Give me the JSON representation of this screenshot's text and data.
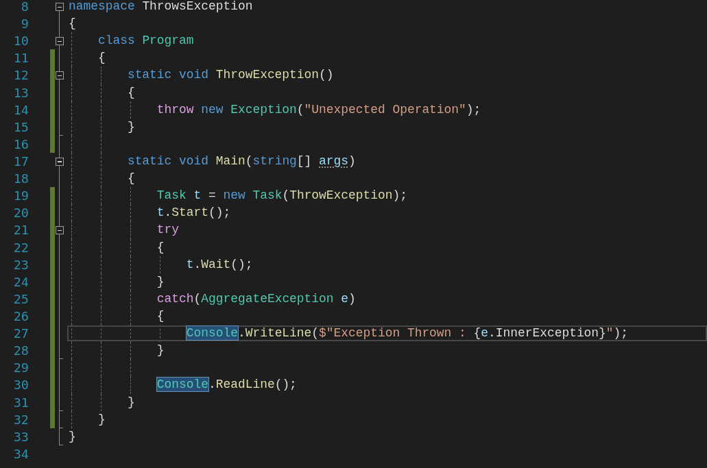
{
  "editor": {
    "lines": [
      {
        "number": "8",
        "changed": false,
        "collapsible": true,
        "fold_end": false,
        "tokens": [
          {
            "text": "namespace ",
            "kind": "keyword"
          },
          {
            "text": "ThrowsException",
            "kind": "plain"
          }
        ]
      },
      {
        "number": "9",
        "changed": false,
        "collapsible": false,
        "fold_end": false,
        "tokens": [
          {
            "text": "{",
            "kind": "plain"
          }
        ]
      },
      {
        "number": "10",
        "changed": false,
        "collapsible": true,
        "fold_end": false,
        "tokens": [
          {
            "text": "    class ",
            "kind": "keyword"
          },
          {
            "text": "Program",
            "kind": "type"
          }
        ]
      },
      {
        "number": "11",
        "changed": true,
        "collapsible": false,
        "fold_end": false,
        "tokens": [
          {
            "text": "    {",
            "kind": "plain"
          }
        ]
      },
      {
        "number": "12",
        "changed": true,
        "collapsible": true,
        "fold_end": false,
        "tokens": [
          {
            "text": "        static void ",
            "kind": "keyword"
          },
          {
            "text": "ThrowException",
            "kind": "method"
          },
          {
            "text": "()",
            "kind": "plain"
          }
        ]
      },
      {
        "number": "13",
        "changed": true,
        "collapsible": false,
        "fold_end": false,
        "tokens": [
          {
            "text": "        {",
            "kind": "plain"
          }
        ]
      },
      {
        "number": "14",
        "changed": true,
        "collapsible": false,
        "fold_end": false,
        "tokens": [
          {
            "text": "            throw ",
            "kind": "control"
          },
          {
            "text": "new ",
            "kind": "keyword"
          },
          {
            "text": "Exception",
            "kind": "type"
          },
          {
            "text": "(",
            "kind": "plain"
          },
          {
            "text": "\"Unexpected Operation\"",
            "kind": "string"
          },
          {
            "text": ");",
            "kind": "plain"
          }
        ]
      },
      {
        "number": "15",
        "changed": true,
        "collapsible": false,
        "fold_end": true,
        "tokens": [
          {
            "text": "        }",
            "kind": "plain"
          }
        ]
      },
      {
        "number": "16",
        "changed": true,
        "collapsible": false,
        "fold_end": false
      },
      {
        "number": "17",
        "changed": false,
        "collapsible": true,
        "fold_end": false,
        "tokens": [
          {
            "text": "        static void ",
            "kind": "keyword"
          },
          {
            "text": "Main",
            "kind": "method"
          },
          {
            "text": "(",
            "kind": "plain"
          },
          {
            "text": "string",
            "kind": "keyword"
          },
          {
            "text": "[] ",
            "kind": "plain"
          },
          {
            "text": "args",
            "kind": "hint"
          },
          {
            "text": ")",
            "kind": "plain"
          }
        ]
      },
      {
        "number": "18",
        "changed": false,
        "collapsible": false,
        "fold_end": false,
        "tokens": [
          {
            "text": "        {",
            "kind": "plain"
          }
        ]
      },
      {
        "number": "19",
        "changed": true,
        "collapsible": false,
        "fold_end": false,
        "tokens": [
          {
            "text": "            Task ",
            "kind": "type"
          },
          {
            "text": "t",
            "kind": "param"
          },
          {
            "text": " = ",
            "kind": "plain"
          },
          {
            "text": "new ",
            "kind": "keyword"
          },
          {
            "text": "Task",
            "kind": "type"
          },
          {
            "text": "(",
            "kind": "plain"
          },
          {
            "text": "ThrowException",
            "kind": "method"
          },
          {
            "text": ");",
            "kind": "plain"
          }
        ]
      },
      {
        "number": "20",
        "changed": true,
        "collapsible": false,
        "fold_end": false,
        "tokens": [
          {
            "text": "            t",
            "kind": "param"
          },
          {
            "text": ".",
            "kind": "plain"
          },
          {
            "text": "Start",
            "kind": "method"
          },
          {
            "text": "();",
            "kind": "plain"
          }
        ]
      },
      {
        "number": "21",
        "changed": true,
        "collapsible": true,
        "fold_end": false,
        "tokens": [
          {
            "text": "            try",
            "kind": "control"
          }
        ]
      },
      {
        "number": "22",
        "changed": true,
        "collapsible": false,
        "fold_end": false,
        "tokens": [
          {
            "text": "            {",
            "kind": "plain"
          }
        ]
      },
      {
        "number": "23",
        "changed": true,
        "collapsible": false,
        "fold_end": false,
        "tokens": [
          {
            "text": "                t",
            "kind": "param"
          },
          {
            "text": ".",
            "kind": "plain"
          },
          {
            "text": "Wait",
            "kind": "method"
          },
          {
            "text": "();",
            "kind": "plain"
          }
        ]
      },
      {
        "number": "24",
        "changed": true,
        "collapsible": false,
        "fold_end": false,
        "tokens": [
          {
            "text": "            }",
            "kind": "plain"
          }
        ]
      },
      {
        "number": "25",
        "changed": true,
        "collapsible": false,
        "fold_end": false,
        "tokens": [
          {
            "text": "            catch",
            "kind": "control"
          },
          {
            "text": "(",
            "kind": "plain"
          },
          {
            "text": "AggregateException ",
            "kind": "type"
          },
          {
            "text": "e",
            "kind": "param"
          },
          {
            "text": ")",
            "kind": "plain"
          }
        ]
      },
      {
        "number": "26",
        "changed": true,
        "collapsible": false,
        "fold_end": false,
        "tokens": [
          {
            "text": "            {",
            "kind": "plain"
          }
        ]
      },
      {
        "number": "27",
        "changed": true,
        "current": true,
        "collapsible": false,
        "fold_end": false,
        "tokens": [
          {
            "text": "                Console",
            "kind": "highlight"
          },
          {
            "text": ".",
            "kind": "plain"
          },
          {
            "text": "WriteLine",
            "kind": "method"
          },
          {
            "text": "(",
            "kind": "plain"
          },
          {
            "text": "$\"Exception Thrown : ",
            "kind": "string"
          },
          {
            "text": "{",
            "kind": "plain"
          },
          {
            "text": "e",
            "kind": "param"
          },
          {
            "text": ".InnerException}",
            "kind": "plain"
          },
          {
            "text": "\"",
            "kind": "string"
          },
          {
            "text": ");",
            "kind": "plain"
          }
        ]
      },
      {
        "number": "28",
        "changed": true,
        "collapsible": false,
        "fold_end": true,
        "tokens": [
          {
            "text": "            }",
            "kind": "plain"
          }
        ]
      },
      {
        "number": "29",
        "changed": true,
        "collapsible": false,
        "fold_end": false
      },
      {
        "number": "30",
        "changed": true,
        "collapsible": false,
        "fold_end": false,
        "tokens": [
          {
            "text": "            Console",
            "kind": "highlight"
          },
          {
            "text": ".",
            "kind": "plain"
          },
          {
            "text": "ReadLine",
            "kind": "method"
          },
          {
            "text": "();",
            "kind": "plain"
          }
        ]
      },
      {
        "number": "31",
        "changed": true,
        "collapsible": false,
        "fold_end": true,
        "tokens": [
          {
            "text": "        }",
            "kind": "plain"
          }
        ]
      },
      {
        "number": "32",
        "changed": true,
        "collapsible": false,
        "fold_end": true,
        "tokens": [
          {
            "text": "    }",
            "kind": "plain"
          }
        ]
      },
      {
        "number": "33",
        "changed": false,
        "collapsible": false,
        "fold_end": true,
        "tokens": [
          {
            "text": "}",
            "kind": "plain"
          }
        ]
      },
      {
        "number": "34",
        "changed": false,
        "collapsible": false,
        "fold_end": false
      }
    ]
  }
}
